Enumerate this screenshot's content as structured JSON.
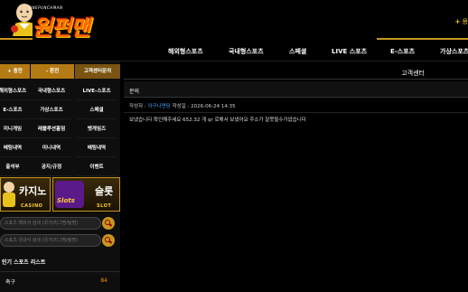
{
  "header": {
    "logo_sub": "ONEPUNCHMAN",
    "logo_main": "원펀맨",
    "top_right": "+",
    "top_right_text": "용"
  },
  "nav": [
    "해외형스포츠",
    "국내형스포츠",
    "스페셜",
    "LIVE 스포츠",
    "E-스포츠",
    "가상스포츠"
  ],
  "sidebar": {
    "quick": [
      "+ 충전",
      "- 환전",
      "고객센터문의"
    ],
    "menu": [
      [
        "해외형스포츠",
        "국내형스포츠",
        "LIVE-스포츠"
      ],
      [
        "E-스포츠",
        "가상스포츠",
        "스페셜"
      ],
      [
        "미니게임",
        "레볼루션홀덤",
        "벳게임즈"
      ],
      [
        "베팅내역",
        "미니내역",
        "배팅내역"
      ],
      [
        "출석부",
        "공지/규정",
        "이벤트"
      ]
    ],
    "banners": {
      "casino": {
        "big": "카지노",
        "small": "CASINO"
      },
      "slot": {
        "big": "슬롯",
        "small": "SLOT",
        "logo": "Slots"
      }
    },
    "search_foreign": "스포츠 해외식 검색 (국가/리그명/팀명)",
    "search_domestic": "스포츠 국내식 검색 (국가/리그명/팀명)",
    "list_title": "인기 스포츠 리스트",
    "list": [
      {
        "name": "축구",
        "count": "84"
      }
    ]
  },
  "main": {
    "title": "고객센터",
    "subject": "문의",
    "meta_prefix": "작성자 : ",
    "author": "아구나면당",
    "meta_date": " 작성일 : 2026-06-24 14:35",
    "body": "보냈습니다 확인해주세요 652.32 개 qr 로해서 보냈어요 주소가 잘못될수가없습니다"
  },
  "colors": {
    "accent": "#c8961e",
    "brand_orange": "#ff6a00",
    "count": "#ff8c00",
    "author": "#4aa3ff"
  }
}
